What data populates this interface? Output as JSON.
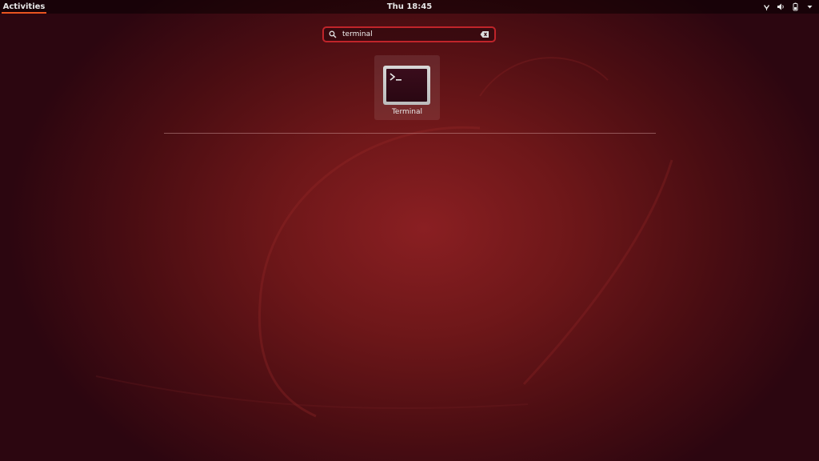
{
  "topbar": {
    "activities_label": "Activities",
    "clock": "Thu 18:45",
    "tray_icons": [
      "network-icon",
      "volume-icon",
      "battery-icon",
      "menu-arrow-icon"
    ]
  },
  "search": {
    "value": "terminal",
    "icon": "search-icon",
    "clear_icon": "clear-icon"
  },
  "results": [
    {
      "label": "Terminal",
      "icon": "terminal-icon"
    }
  ],
  "colors": {
    "accent": "#e95420",
    "search_border": "#c0242a",
    "wallpaper_center": "#8a1f22",
    "wallpaper_edge": "#2c0610"
  }
}
